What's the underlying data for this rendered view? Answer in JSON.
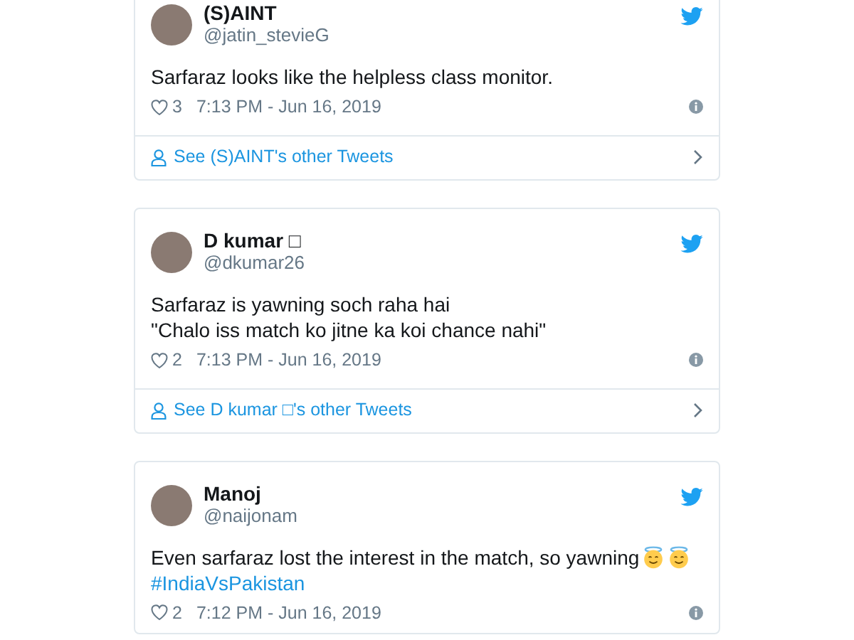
{
  "tweets": [
    {
      "name": "(S)AINT",
      "handle": "@jatin_stevieG",
      "lines": [
        {
          "kind": "text",
          "text": "Sarfaraz looks like the helpless class monitor."
        }
      ],
      "likes": "3",
      "time": "7:13 PM - Jun 16, 2019",
      "footer": "See (S)AINT's other Tweets"
    },
    {
      "name": "D kumar □",
      "handle": "@dkumar26",
      "lines": [
        {
          "kind": "text",
          "text": "Sarfaraz is yawning soch raha hai"
        },
        {
          "kind": "text",
          "text": "\"Chalo iss match ko jitne ka koi chance nahi\""
        }
      ],
      "likes": "2",
      "time": "7:13 PM - Jun 16, 2019",
      "footer": "See D kumar □'s other Tweets"
    },
    {
      "name": "Manoj",
      "handle": "@naijonam",
      "lines": [
        {
          "kind": "text-with-emoji",
          "text": "Even sarfaraz lost the interest in the match, so yawning"
        },
        {
          "kind": "hashtag",
          "text": "#IndiaVsPakistan"
        }
      ],
      "likes": "2",
      "time": "7:12 PM - Jun 16, 2019"
    }
  ]
}
